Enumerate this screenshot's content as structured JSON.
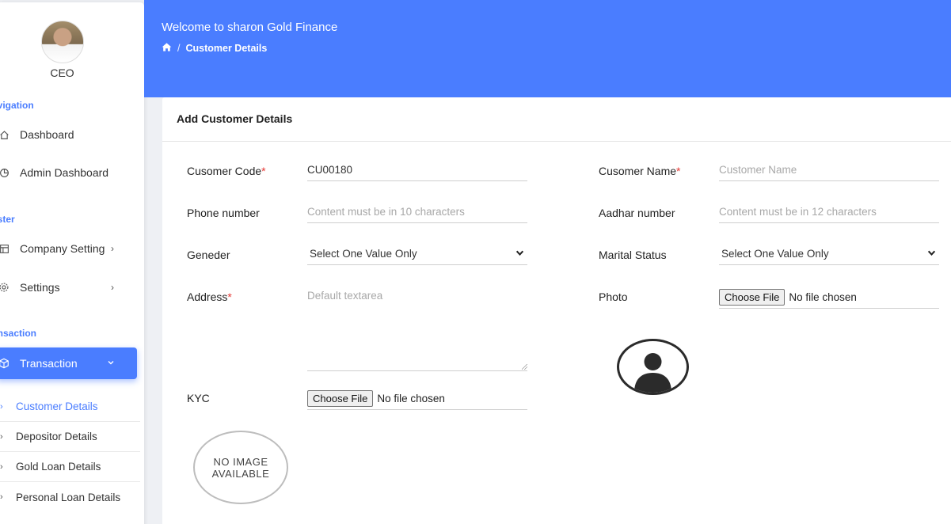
{
  "sidebar": {
    "user_role": "CEO",
    "sections": [
      "avigation",
      "aster",
      "ansaction"
    ],
    "nav": [
      {
        "label": "Dashboard",
        "icon": "home-icon"
      },
      {
        "label": "Admin Dashboard",
        "icon": "pie-chart-icon"
      },
      {
        "label": "Company Setting",
        "icon": "layout-icon"
      },
      {
        "label": "Settings",
        "icon": "gear-icon"
      },
      {
        "label": "Transaction",
        "icon": "cube-icon"
      }
    ],
    "sub_items": [
      {
        "label": "Customer Details"
      },
      {
        "label": "Depositor Details"
      },
      {
        "label": "Gold Loan Details"
      },
      {
        "label": "Personal Loan Details"
      }
    ]
  },
  "header": {
    "welcome": "Welcome to sharon Gold Finance",
    "breadcrumb_current": "Customer Details",
    "breadcrumb_sep": "/"
  },
  "form": {
    "title": "Add Customer Details",
    "customer_code_label": "Cusomer Code",
    "customer_code_value": "CU00180",
    "customer_name_label": "Cusomer Name",
    "customer_name_placeholder": "Customer Name",
    "phone_label": "Phone number",
    "phone_placeholder": "Content must be in 10 characters",
    "aadhar_label": "Aadhar number",
    "aadhar_placeholder": "Content must be in 12 characters",
    "gender_label": "Geneder",
    "gender_value": "Select One Value Only",
    "marital_label": "Marital Status",
    "marital_value": "Select One Value Only",
    "address_label": "Address",
    "address_placeholder": "Default textarea",
    "photo_label": "Photo",
    "kyc_label": "KYC",
    "choose_file": "Choose File",
    "no_file": "No file chosen",
    "required_mark": "*",
    "no_image_line1": "NO IMAGE",
    "no_image_line2": "AVAILABLE"
  },
  "colors": {
    "accent": "#4a7dff",
    "required": "#e53935"
  }
}
